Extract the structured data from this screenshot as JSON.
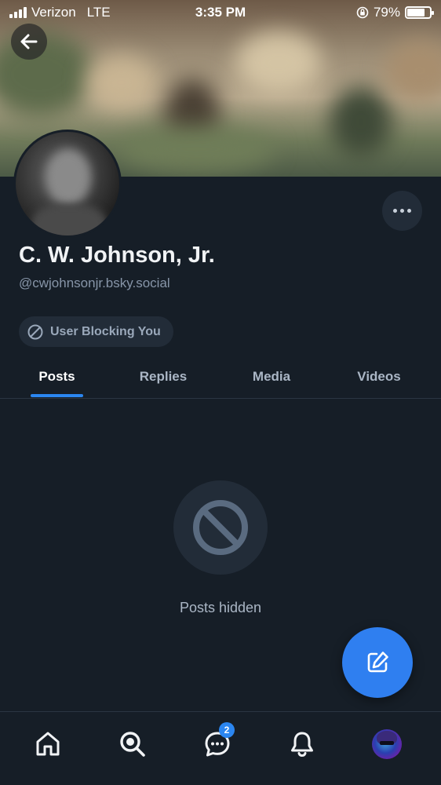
{
  "status_bar": {
    "carrier": "Verizon",
    "network": "LTE",
    "time": "3:35 PM",
    "battery_percent": "79%",
    "battery_level": 0.79
  },
  "profile": {
    "display_name": "C. W. Johnson, Jr.",
    "handle": "@cwjohnsonjr.bsky.social",
    "block_label": "User Blocking You"
  },
  "tabs": [
    {
      "label": "Posts",
      "active": true
    },
    {
      "label": "Replies",
      "active": false
    },
    {
      "label": "Media",
      "active": false
    },
    {
      "label": "Videos",
      "active": false
    }
  ],
  "empty_state": {
    "message": "Posts hidden"
  },
  "bottom_nav": {
    "items": [
      "home-icon",
      "search-icon",
      "chat-icon",
      "bell-icon",
      "profile-avatar"
    ],
    "chat_badge": "2"
  },
  "colors": {
    "accent": "#2b86f0",
    "fab": "#2f7ff0",
    "background": "#161e27",
    "surface": "#222c38"
  }
}
